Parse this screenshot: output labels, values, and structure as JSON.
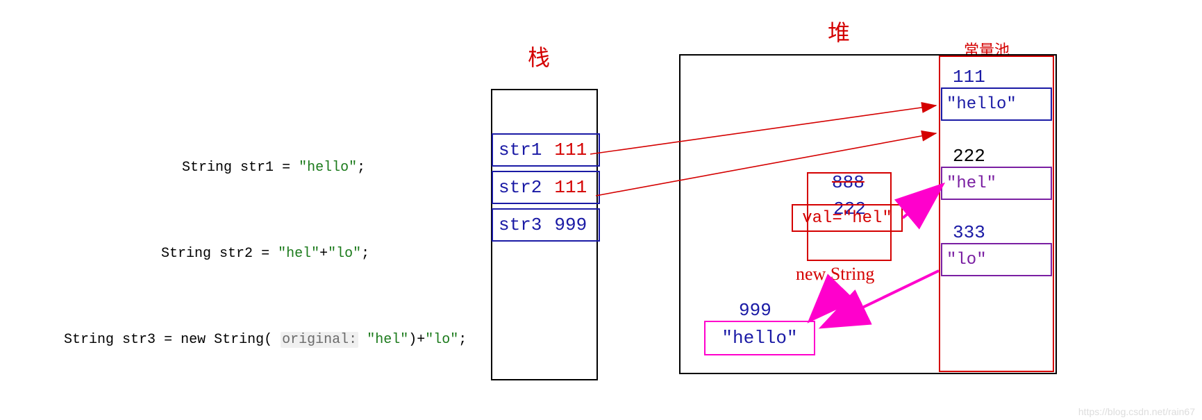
{
  "code": {
    "line1": {
      "type": "String",
      "var": "str1",
      "eq": " = ",
      "lit": "\"hello\"",
      "end": ";"
    },
    "line2": {
      "type": "String",
      "var": "str2",
      "eq": " = ",
      "lit1": "\"hel\"",
      "plus": "+",
      "lit2": "\"lo\"",
      "end": ";"
    },
    "line3": {
      "type": "String",
      "var": "str3",
      "eq": " = ",
      "new": "new",
      "cls": "String",
      "open": "( ",
      "hint": "original:",
      "sp": " ",
      "lit1": "\"hel\"",
      "close": ")",
      "plus": "+",
      "lit2": "\"lo\"",
      "end": ";"
    }
  },
  "labels": {
    "stack": "栈",
    "heap": "堆",
    "pool": "常量池",
    "newString": "new String"
  },
  "stack": {
    "r1": {
      "name": "str1",
      "addr": "111"
    },
    "r2": {
      "name": "str2",
      "addr": "111"
    },
    "r3": {
      "name": "str3",
      "addr": "999"
    }
  },
  "pool": {
    "p1": {
      "addr": "111",
      "val": "\"hello\""
    },
    "p2": {
      "addr": "222",
      "val": "\"hel\""
    },
    "p3": {
      "addr": "333",
      "val": "\"lo\""
    }
  },
  "heapObj": {
    "addr": "888",
    "innerAddr": "222",
    "valLabel": "val=\"hel\""
  },
  "sb": {
    "addr": "999",
    "val": "\"hello\""
  },
  "watermark": "https://blog.csdn.net/rain67"
}
